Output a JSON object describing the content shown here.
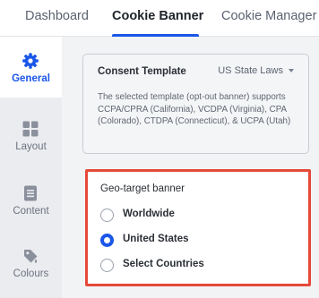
{
  "tabs": [
    {
      "label": "Dashboard",
      "active": false
    },
    {
      "label": "Cookie Banner",
      "active": true
    },
    {
      "label": "Cookie Manager",
      "active": false
    }
  ],
  "sidebar": {
    "items": [
      {
        "label": "General",
        "icon": "gear-icon",
        "active": true
      },
      {
        "label": "Layout",
        "icon": "grid-icon",
        "active": false
      },
      {
        "label": "Content",
        "icon": "document-icon",
        "active": false
      },
      {
        "label": "Colours",
        "icon": "paint-tag-icon",
        "active": false
      }
    ]
  },
  "consent_template": {
    "title": "Consent Template",
    "selected": "US State Laws",
    "description": "The selected template (opt-out banner) supports CCPA/CPRA (California), VCDPA (Virginia), CPA (Colorado), CTDPA (Connecticut), & UCPA (Utah)"
  },
  "geo_target": {
    "title": "Geo-target banner",
    "options": [
      {
        "label": "Worldwide",
        "checked": false
      },
      {
        "label": "United States",
        "checked": true
      },
      {
        "label": "Select Countries",
        "checked": false
      }
    ]
  },
  "colors": {
    "accent": "#1a56e8",
    "highlight_border": "#e5493a"
  }
}
